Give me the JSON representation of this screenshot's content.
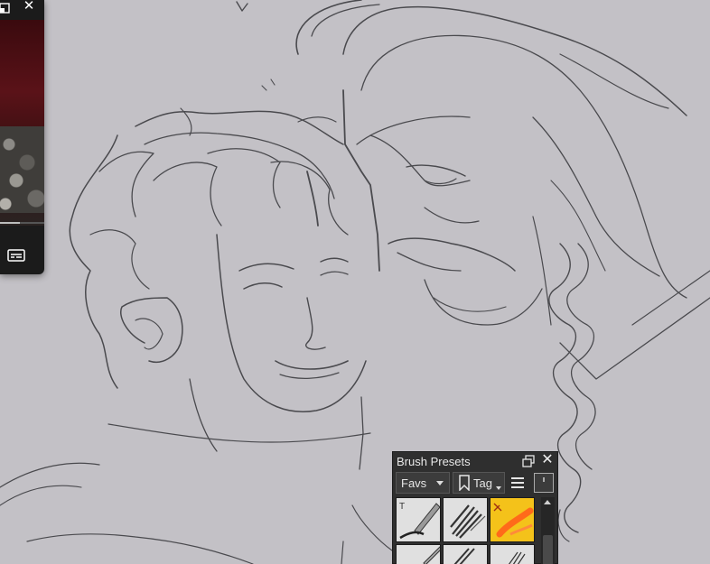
{
  "mini_player": {
    "restore_icon": "restore-window-icon",
    "close_icon": "close-icon",
    "close_glyph": "✕",
    "captions_icon": "closed-captions-icon",
    "progress": 0.45
  },
  "brush_docker": {
    "title": "Brush Presets",
    "float_icon": "float-docker-icon",
    "close_icon": "close-icon",
    "close_glyph": "✕",
    "tag_filter": "Favs",
    "tag_button_label": "Tag",
    "tag_icon": "bookmark-icon",
    "menu_icon": "hamburger-menu-icon",
    "info_icon": "info-icon",
    "selected_accent": "#f4c21a",
    "presets": [
      {
        "icon": "ink-pen-brush-icon",
        "selected": false
      },
      {
        "icon": "charcoal-texture-brush-icon",
        "selected": false
      },
      {
        "icon": "marker-brush-icon",
        "selected": true
      },
      {
        "icon": "pencil-brush-icon",
        "selected": false
      },
      {
        "icon": "hatching-brush-icon",
        "selected": false
      },
      {
        "icon": "bristle-brush-icon",
        "selected": false
      }
    ]
  },
  "canvas": {
    "background": "#c3c1c6",
    "stroke_color": "#4a4a4e"
  }
}
